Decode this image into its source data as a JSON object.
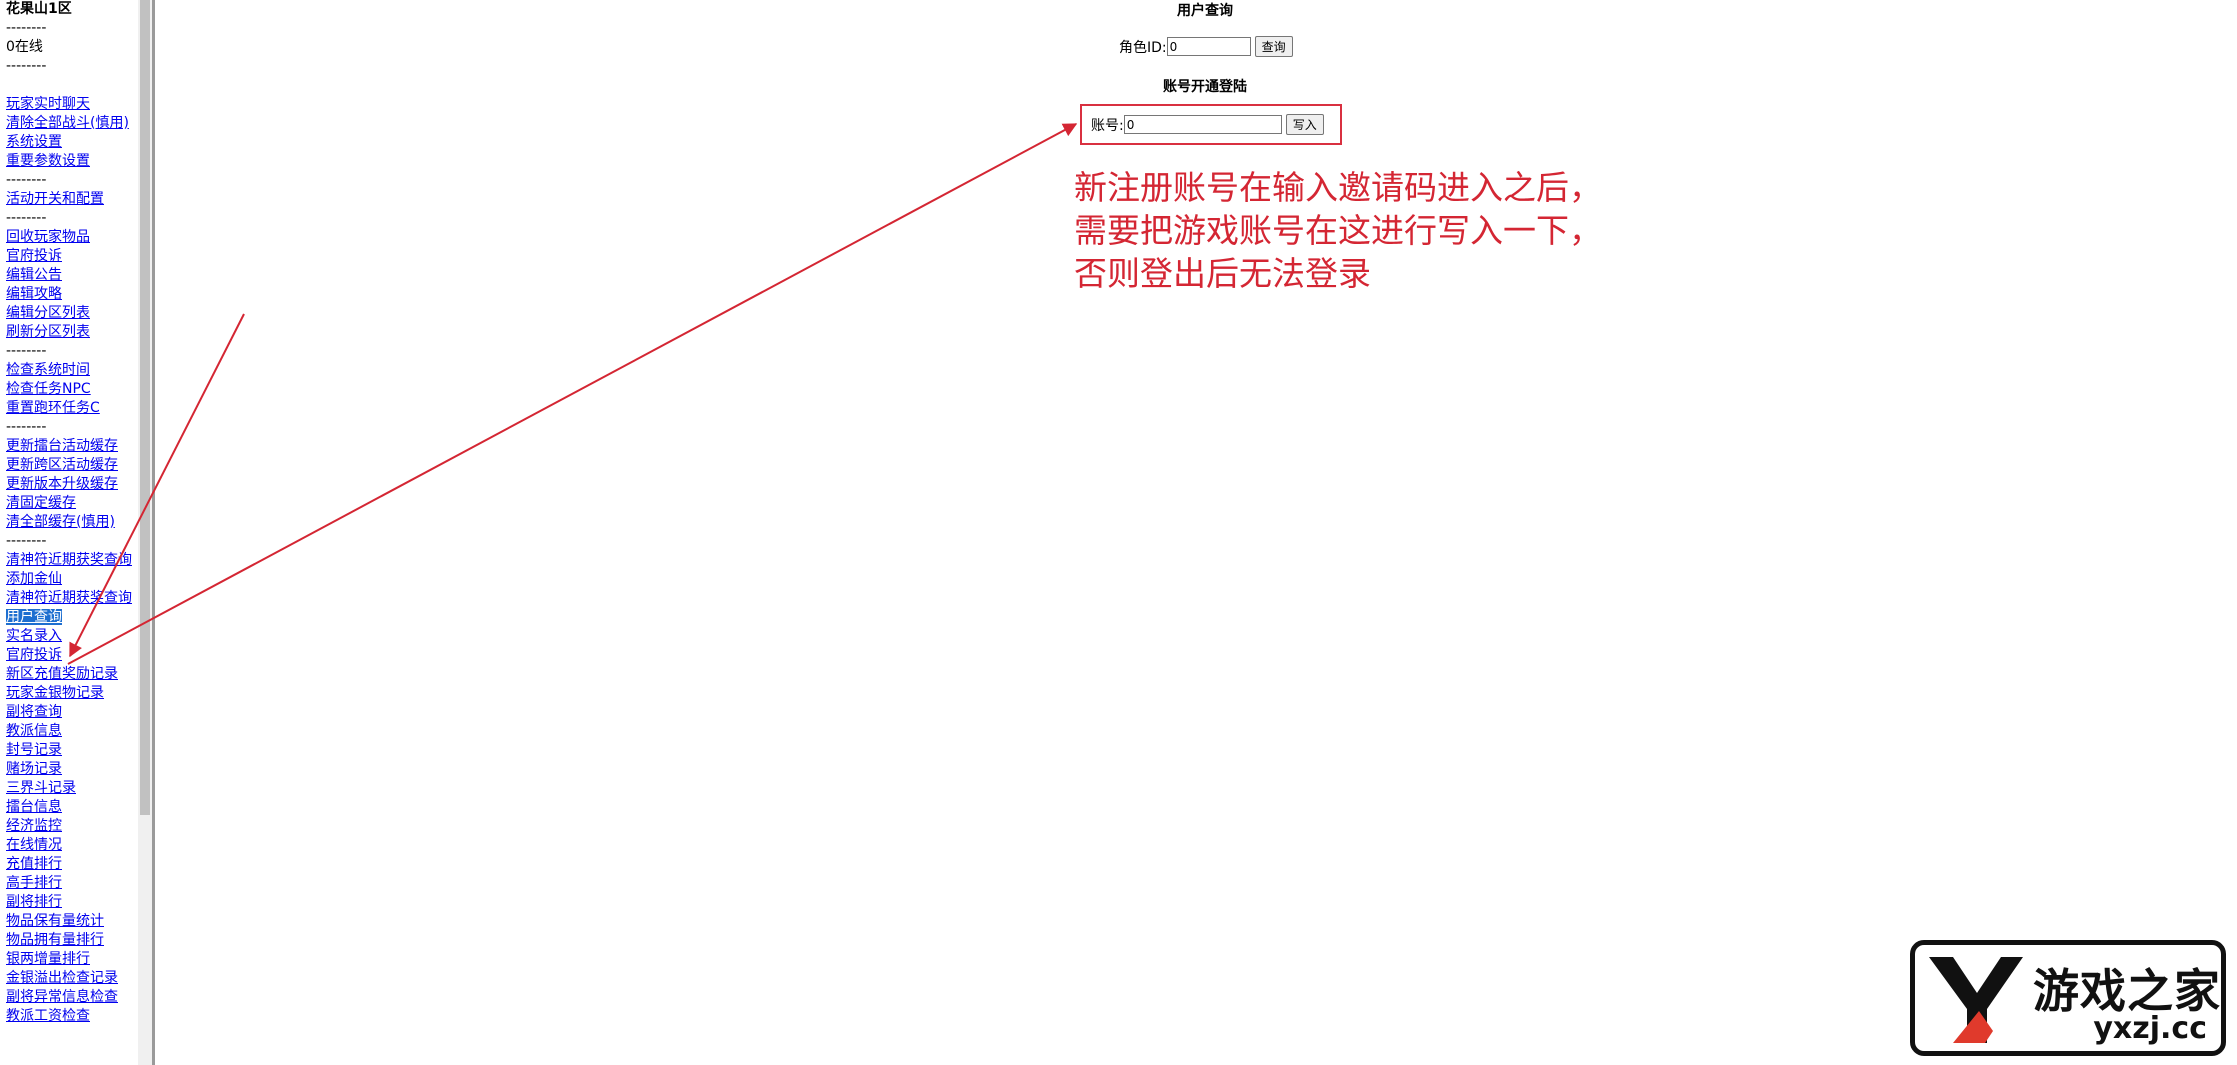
{
  "sidebar": {
    "server_name": "花果山1区",
    "sep": "--------",
    "online": "0在线",
    "items": [
      {
        "type": "sep"
      },
      {
        "type": "blank"
      },
      {
        "type": "link",
        "label": "玩家实时聊天"
      },
      {
        "type": "link",
        "label": "清除全部战斗(慎用)"
      },
      {
        "type": "link",
        "label": "系统设置"
      },
      {
        "type": "link",
        "label": "重要参数设置"
      },
      {
        "type": "sep"
      },
      {
        "type": "link",
        "label": "活动开关和配置"
      },
      {
        "type": "sep"
      },
      {
        "type": "link",
        "label": "回收玩家物品"
      },
      {
        "type": "link",
        "label": "官府投诉"
      },
      {
        "type": "link",
        "label": "编辑公告"
      },
      {
        "type": "link",
        "label": "编辑攻略"
      },
      {
        "type": "link",
        "label": "编辑分区列表"
      },
      {
        "type": "link",
        "label": "刷新分区列表"
      },
      {
        "type": "sep"
      },
      {
        "type": "link",
        "label": "检查系统时间"
      },
      {
        "type": "link",
        "label": "检查任务NPC"
      },
      {
        "type": "link",
        "label": "重置跑环任务C"
      },
      {
        "type": "sep"
      },
      {
        "type": "link",
        "label": "更新擂台活动缓存"
      },
      {
        "type": "link",
        "label": "更新跨区活动缓存"
      },
      {
        "type": "link",
        "label": "更新版本升级缓存"
      },
      {
        "type": "link",
        "label": "清固定缓存"
      },
      {
        "type": "link",
        "label": "清全部缓存(慎用)"
      },
      {
        "type": "sep"
      },
      {
        "type": "link",
        "label": "清神符近期获奖查询"
      },
      {
        "type": "link",
        "label": "添加金仙"
      },
      {
        "type": "link",
        "label": "清神符近期获奖查询"
      },
      {
        "type": "link",
        "label": "用户查询",
        "active": true
      },
      {
        "type": "link",
        "label": "实名录入"
      },
      {
        "type": "link",
        "label": "官府投诉"
      },
      {
        "type": "link",
        "label": "新区充值奖励记录"
      },
      {
        "type": "link",
        "label": "玩家金银物记录"
      },
      {
        "type": "link",
        "label": "副将查询"
      },
      {
        "type": "link",
        "label": "教派信息"
      },
      {
        "type": "link",
        "label": "封号记录"
      },
      {
        "type": "link",
        "label": "赌场记录"
      },
      {
        "type": "link",
        "label": "三界斗记录"
      },
      {
        "type": "link",
        "label": "擂台信息"
      },
      {
        "type": "link",
        "label": "经济监控"
      },
      {
        "type": "link",
        "label": "在线情况"
      },
      {
        "type": "link",
        "label": "充值排行"
      },
      {
        "type": "link",
        "label": "高手排行"
      },
      {
        "type": "link",
        "label": "副将排行"
      },
      {
        "type": "link",
        "label": "物品保有量统计"
      },
      {
        "type": "link",
        "label": "物品拥有量排行"
      },
      {
        "type": "link",
        "label": "银两增量排行"
      },
      {
        "type": "link",
        "label": "金银溢出检查记录"
      },
      {
        "type": "link",
        "label": "副将异常信息检查"
      },
      {
        "type": "link",
        "label": "教派工资检查"
      }
    ]
  },
  "main": {
    "user_query": {
      "title": "用户查询",
      "label": "角色ID:",
      "value": "0",
      "button": "查询"
    },
    "account_login": {
      "title": "账号开通登陆",
      "label": "账号:",
      "value": "0",
      "button": "写入"
    }
  },
  "annotation": {
    "color": "#d42633",
    "lines": [
      "新注册账号在输入邀请码进入之后，",
      "需要把游戏账号在这进行写入一下，",
      "否则登出后无法登录"
    ]
  },
  "watermark": {
    "name": "游戏之家",
    "domain": "yxzj.cc",
    "accent": "#e03a2c"
  }
}
